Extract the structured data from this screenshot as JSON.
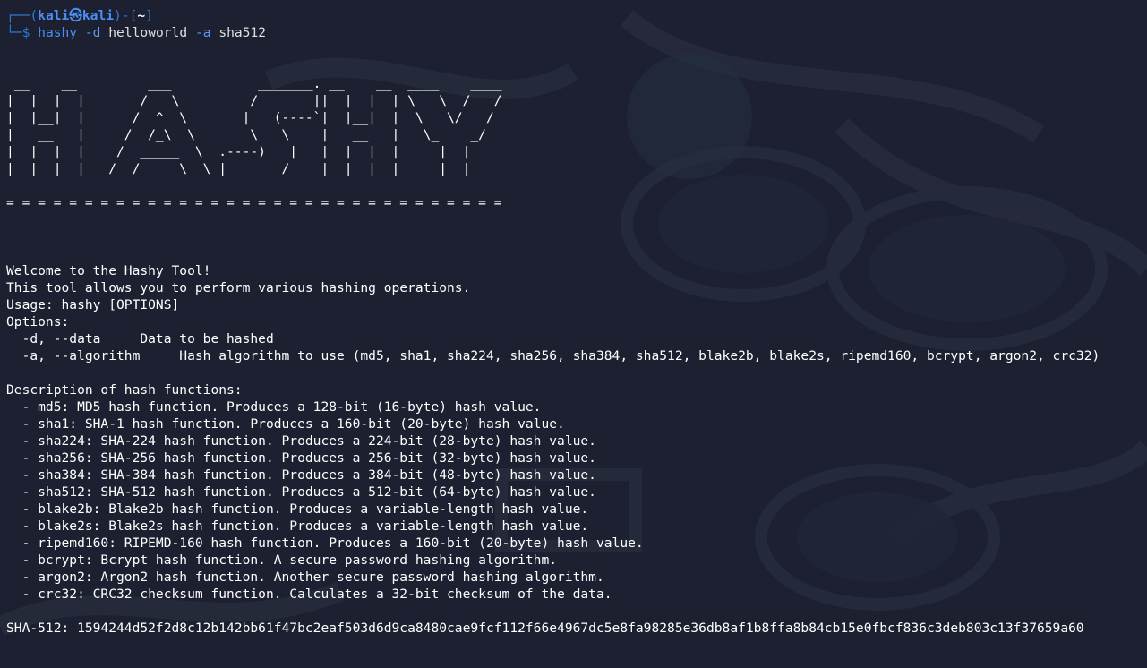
{
  "prompt": {
    "frame_top": "┌──(",
    "user": "kali㉿kali",
    "frame_mid": ")-[",
    "dir": "~",
    "frame_end": "]",
    "frame_bottom": "└─$",
    "command": "hashy",
    "flag1": "-d",
    "arg1": "helloworld",
    "flag2": "-a",
    "arg2": "sha512"
  },
  "banner": {
    "ascii_art": " __    __         ___           _______. __    __  ____    ____\n|  |  |  |       /   \\         /       ||  |  |  | \\   \\  /   /\n|  |__|  |      /  ^  \\       |   (----`|  |__|  |  \\   \\/   /\n|   __   |     /  /_\\  \\       \\   \\    |   __   |   \\_    _/\n|  |  |  |    /  _____  \\  .----)   |   |  |  |  |     |  |\n|__|  |__|   /__/     \\__\\ |_______/    |__|  |__|     |__|",
    "separator": "= = = = = = = = = = = = = = = = = = = = = = = = = = = = = = = ="
  },
  "help": {
    "welcome": "Welcome to the Hashy Tool!",
    "about": "This tool allows you to perform various hashing operations.",
    "usage": "Usage: hashy [OPTIONS]",
    "options_header": "Options:",
    "opt_data": "  -d, --data     Data to be hashed",
    "opt_algorithm": "  -a, --algorithm     Hash algorithm to use (md5, sha1, sha224, sha256, sha384, sha512, blake2b, blake2s, ripemd160, bcrypt, argon2, crc32)",
    "desc_header": "Description of hash functions:",
    "descriptions": [
      "  - md5: MD5 hash function. Produces a 128-bit (16-byte) hash value.",
      "  - sha1: SHA-1 hash function. Produces a 160-bit (20-byte) hash value.",
      "  - sha224: SHA-224 hash function. Produces a 224-bit (28-byte) hash value.",
      "  - sha256: SHA-256 hash function. Produces a 256-bit (32-byte) hash value.",
      "  - sha384: SHA-384 hash function. Produces a 384-bit (48-byte) hash value.",
      "  - sha512: SHA-512 hash function. Produces a 512-bit (64-byte) hash value.",
      "  - blake2b: Blake2b hash function. Produces a variable-length hash value.",
      "  - blake2s: Blake2s hash function. Produces a variable-length hash value.",
      "  - ripemd160: RIPEMD-160 hash function. Produces a 160-bit (20-byte) hash value.",
      "  - bcrypt: Bcrypt hash function. A secure password hashing algorithm.",
      "  - argon2: Argon2 hash function. Another secure password hashing algorithm.",
      "  - crc32: CRC32 checksum function. Calculates a 32-bit checksum of the data."
    ]
  },
  "result": {
    "line": "SHA-512: 1594244d52f2d8c12b142bb61f47bc2eaf503d6d9ca8480cae9fcf112f66e4967dc5e8fa98285e36db8af1b8ffa8b84cb15e0fbcf836c3deb803c13f37659a60"
  },
  "colors": {
    "background": "#1c2030",
    "prompt_blue": "#4a8ff5",
    "text": "#ffffff"
  }
}
